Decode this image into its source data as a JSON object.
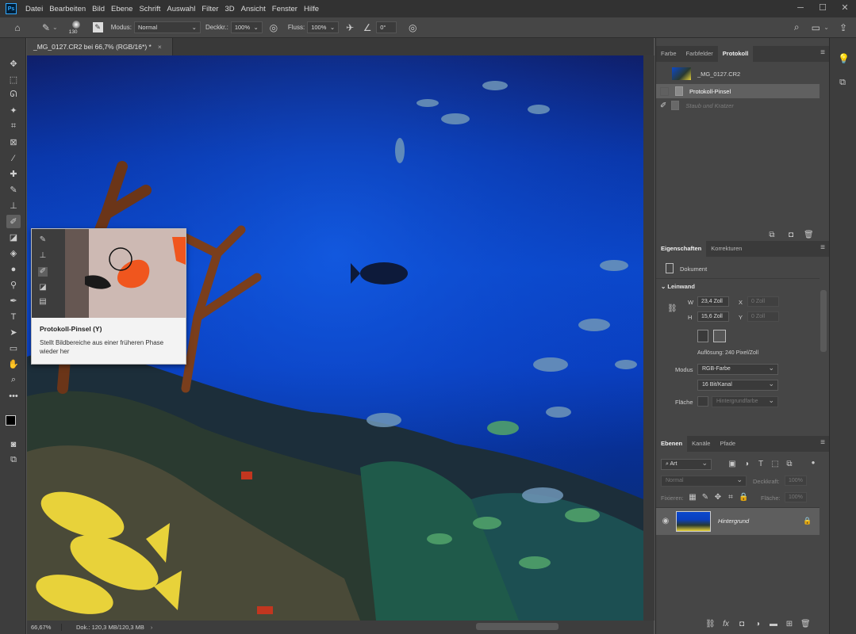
{
  "menubar": {
    "logo": "Ps",
    "items": [
      "Datei",
      "Bearbeiten",
      "Bild",
      "Ebene",
      "Schrift",
      "Auswahl",
      "Filter",
      "3D",
      "Ansicht",
      "Fenster",
      "Hilfe"
    ]
  },
  "options": {
    "brush_size": "130",
    "modus_label": "Modus:",
    "modus_value": "Normal",
    "deckkraft_label": "Deckkr.:",
    "deckkraft_value": "100%",
    "fluss_label": "Fluss:",
    "fluss_value": "100%",
    "angle_value": "0°"
  },
  "document": {
    "tab_title": "_MG_0127.CR2 bei 66,7% (RGB/16*) *",
    "zoom": "66,67%",
    "doc_info": "Dok.: 120,3 MB/120,3 MB"
  },
  "tooltip": {
    "title": "Protokoll-Pinsel (Y)",
    "description": "Stellt Bildbereiche aus einer früheren Phase wieder her"
  },
  "history_panel": {
    "tabs": [
      "Farbe",
      "Farbfelder",
      "Protokoll"
    ],
    "active_tab": "Protokoll",
    "snapshot": "_MG_0127.CR2",
    "states": [
      {
        "label": "Protokoll-Pinsel",
        "state": "selected"
      },
      {
        "label": "Staub und Kratzer",
        "state": "dimmed"
      }
    ]
  },
  "properties_panel": {
    "tabs": [
      "Eigenschaften",
      "Korrekturen"
    ],
    "active_tab": "Eigenschaften",
    "type": "Dokument",
    "section": "Leinwand",
    "w_label": "W",
    "w_value": "23,4 Zoll",
    "h_label": "H",
    "h_value": "15,6 Zoll",
    "x_label": "X",
    "x_value": "0 Zoll",
    "y_label": "Y",
    "y_value": "0 Zoll",
    "resolution": "Auflösung: 240 Pixel/Zoll",
    "modus_label": "Modus",
    "modus_value": "RGB-Farbe",
    "depth_value": "16 Bit/Kanal",
    "flaeche_label": "Fläche",
    "flaeche_value": "Hintergrundfarbe"
  },
  "layers_panel": {
    "tabs": [
      "Ebenen",
      "Kanäle",
      "Pfade"
    ],
    "active_tab": "Ebenen",
    "filter_placeholder": "Art",
    "blend_mode": "Normal",
    "opacity_label": "Deckkraft:",
    "opacity_value": "100%",
    "fix_label": "Fixieren:",
    "fill_label": "Fläche:",
    "fill_value": "100%",
    "layers": [
      {
        "name": "Hintergrund",
        "locked": true,
        "visible": true
      }
    ]
  },
  "colors": {
    "accent_blue": "#0b48cb",
    "panel_bg": "#464646",
    "app_bg": "#323232"
  }
}
